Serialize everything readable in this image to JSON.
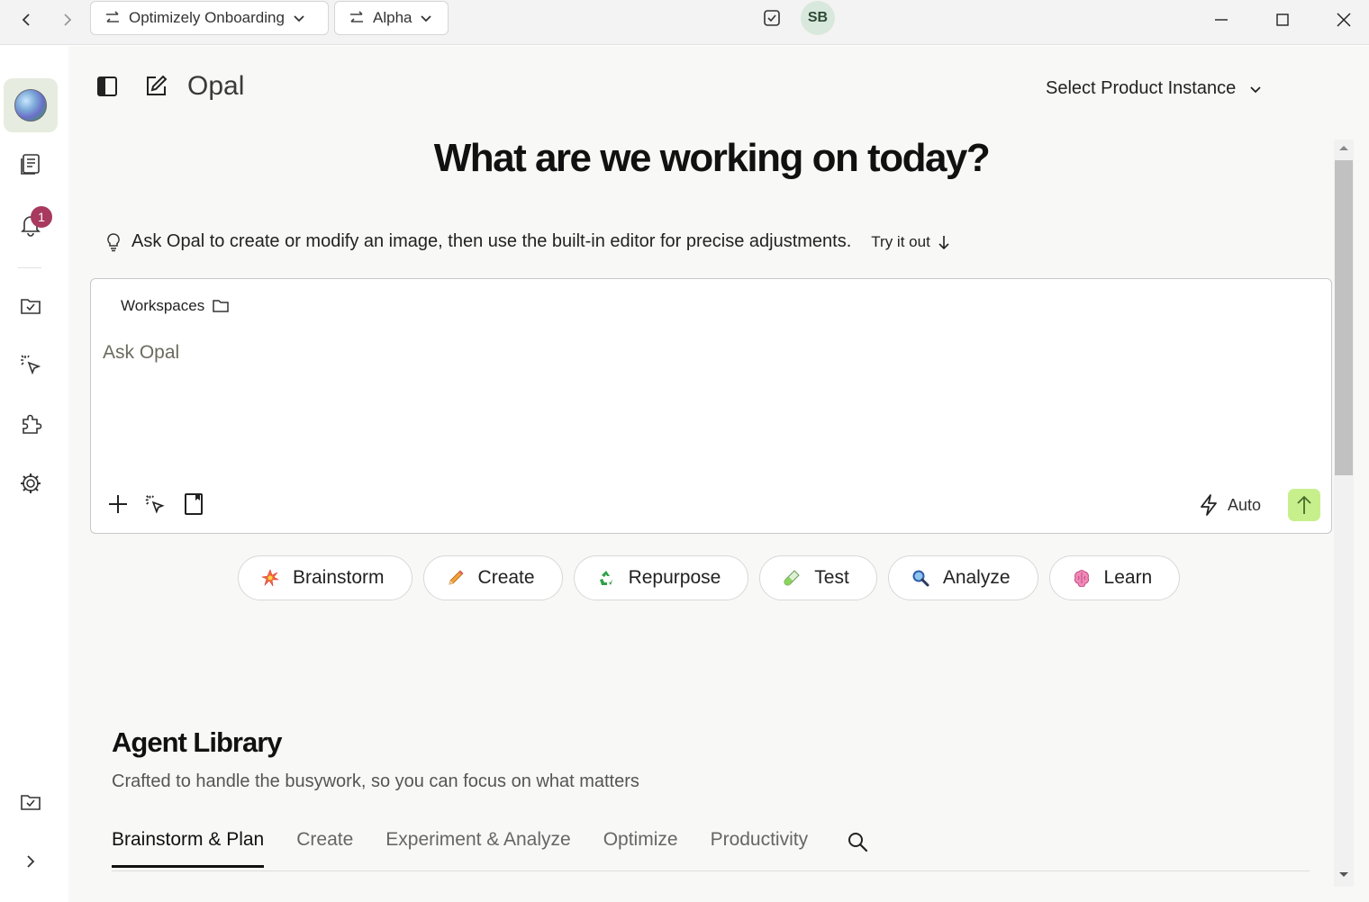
{
  "titlebar": {
    "org_selector": "Optimizely Onboarding",
    "env_selector": "Alpha",
    "avatar_initials": "SB"
  },
  "rail": {
    "notification_count": "1"
  },
  "header": {
    "app_title": "Opal",
    "product_instance_label": "Select Product Instance"
  },
  "hero": {
    "heading": "What are we working on today?"
  },
  "tip": {
    "text": "Ask Opal to create or modify an image, then use the built-in editor for precise adjustments.",
    "try_label": "Try it out"
  },
  "prompt": {
    "workspaces_label": "Workspaces",
    "placeholder": "Ask Opal",
    "mode_label": "Auto"
  },
  "chips": [
    {
      "label": "Brainstorm",
      "icon": "collision-emoji"
    },
    {
      "label": "Create",
      "icon": "pencil-emoji"
    },
    {
      "label": "Repurpose",
      "icon": "recycle-emoji"
    },
    {
      "label": "Test",
      "icon": "test-tube-emoji"
    },
    {
      "label": "Analyze",
      "icon": "magnifier-emoji"
    },
    {
      "label": "Learn",
      "icon": "brain-emoji"
    }
  ],
  "library": {
    "title": "Agent Library",
    "subtitle": "Crafted to handle the busywork, so you can focus on what matters",
    "tabs": [
      "Brainstorm & Plan",
      "Create",
      "Experiment & Analyze",
      "Optimize",
      "Productivity"
    ],
    "active_tab": "Brainstorm & Plan"
  },
  "colors": {
    "accent_send": "#c7f08c",
    "badge": "#a73a5e",
    "home_highlight": "#e6ecdf",
    "avatar_bg": "#d9e8dc"
  }
}
